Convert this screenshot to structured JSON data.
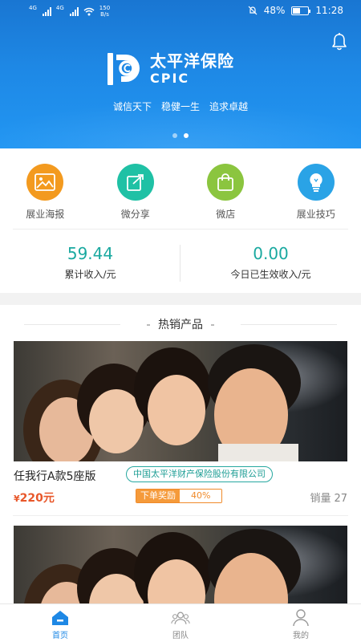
{
  "status_bar": {
    "network_1": "4G",
    "network_2": "4G",
    "speed_value": "150",
    "speed_unit": "B/s",
    "battery": "48%",
    "battery_level": 0.48,
    "time": "11:28"
  },
  "banner": {
    "brand_cn": "太平洋保险",
    "brand_en": "CPIC",
    "slogans": [
      "诚信天下",
      "稳健一生",
      "追求卓越"
    ],
    "page_count": 2,
    "active_page": 2
  },
  "menu": [
    {
      "label": "展业海报",
      "icon": "poster-image-icon",
      "color": "#f39a1f"
    },
    {
      "label": "微分享",
      "icon": "share-icon",
      "color": "#1fc1a5"
    },
    {
      "label": "微店",
      "icon": "shopping-bag-icon",
      "color": "#8bc53f"
    },
    {
      "label": "展业技巧",
      "icon": "lightbulb-icon",
      "color": "#2aa3e6"
    }
  ],
  "stats": {
    "total_income_value": "59.44",
    "total_income_label": "累计收入/元",
    "today_income_value": "0.00",
    "today_income_label": "今日已生效收入/元"
  },
  "hot": {
    "title": "热销产品",
    "products": [
      {
        "name": "任我行A款5座版",
        "company": "中国太平洋财产保险股份有限公司",
        "currency": "¥",
        "price": "220元",
        "reward_label": "下单奖励",
        "reward_value": "40%",
        "sales_label": "销量",
        "sales_value": "27"
      }
    ]
  },
  "tabs": [
    {
      "label": "首页",
      "icon": "home-icon",
      "active": true
    },
    {
      "label": "团队",
      "icon": "team-icon",
      "active": false
    },
    {
      "label": "我的",
      "icon": "user-icon",
      "active": false
    }
  ],
  "colors": {
    "primary": "#1e88e5",
    "teal": "#1aa9a0",
    "price": "#e8572a",
    "reward": "#f59a3a"
  }
}
